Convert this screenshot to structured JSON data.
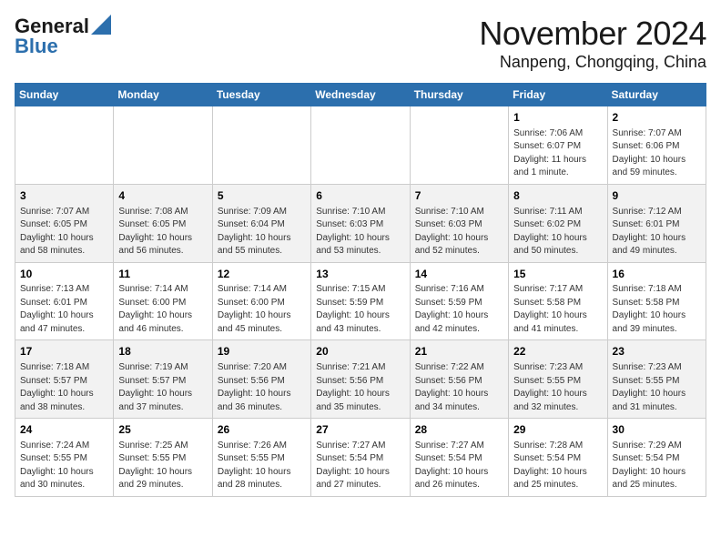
{
  "header": {
    "logo_line1": "General",
    "logo_line2": "Blue",
    "month": "November 2024",
    "location": "Nanpeng, Chongqing, China"
  },
  "weekdays": [
    "Sunday",
    "Monday",
    "Tuesday",
    "Wednesday",
    "Thursday",
    "Friday",
    "Saturday"
  ],
  "weeks": [
    [
      {
        "day": "",
        "info": ""
      },
      {
        "day": "",
        "info": ""
      },
      {
        "day": "",
        "info": ""
      },
      {
        "day": "",
        "info": ""
      },
      {
        "day": "",
        "info": ""
      },
      {
        "day": "1",
        "info": "Sunrise: 7:06 AM\nSunset: 6:07 PM\nDaylight: 11 hours\nand 1 minute."
      },
      {
        "day": "2",
        "info": "Sunrise: 7:07 AM\nSunset: 6:06 PM\nDaylight: 10 hours\nand 59 minutes."
      }
    ],
    [
      {
        "day": "3",
        "info": "Sunrise: 7:07 AM\nSunset: 6:05 PM\nDaylight: 10 hours\nand 58 minutes."
      },
      {
        "day": "4",
        "info": "Sunrise: 7:08 AM\nSunset: 6:05 PM\nDaylight: 10 hours\nand 56 minutes."
      },
      {
        "day": "5",
        "info": "Sunrise: 7:09 AM\nSunset: 6:04 PM\nDaylight: 10 hours\nand 55 minutes."
      },
      {
        "day": "6",
        "info": "Sunrise: 7:10 AM\nSunset: 6:03 PM\nDaylight: 10 hours\nand 53 minutes."
      },
      {
        "day": "7",
        "info": "Sunrise: 7:10 AM\nSunset: 6:03 PM\nDaylight: 10 hours\nand 52 minutes."
      },
      {
        "day": "8",
        "info": "Sunrise: 7:11 AM\nSunset: 6:02 PM\nDaylight: 10 hours\nand 50 minutes."
      },
      {
        "day": "9",
        "info": "Sunrise: 7:12 AM\nSunset: 6:01 PM\nDaylight: 10 hours\nand 49 minutes."
      }
    ],
    [
      {
        "day": "10",
        "info": "Sunrise: 7:13 AM\nSunset: 6:01 PM\nDaylight: 10 hours\nand 47 minutes."
      },
      {
        "day": "11",
        "info": "Sunrise: 7:14 AM\nSunset: 6:00 PM\nDaylight: 10 hours\nand 46 minutes."
      },
      {
        "day": "12",
        "info": "Sunrise: 7:14 AM\nSunset: 6:00 PM\nDaylight: 10 hours\nand 45 minutes."
      },
      {
        "day": "13",
        "info": "Sunrise: 7:15 AM\nSunset: 5:59 PM\nDaylight: 10 hours\nand 43 minutes."
      },
      {
        "day": "14",
        "info": "Sunrise: 7:16 AM\nSunset: 5:59 PM\nDaylight: 10 hours\nand 42 minutes."
      },
      {
        "day": "15",
        "info": "Sunrise: 7:17 AM\nSunset: 5:58 PM\nDaylight: 10 hours\nand 41 minutes."
      },
      {
        "day": "16",
        "info": "Sunrise: 7:18 AM\nSunset: 5:58 PM\nDaylight: 10 hours\nand 39 minutes."
      }
    ],
    [
      {
        "day": "17",
        "info": "Sunrise: 7:18 AM\nSunset: 5:57 PM\nDaylight: 10 hours\nand 38 minutes."
      },
      {
        "day": "18",
        "info": "Sunrise: 7:19 AM\nSunset: 5:57 PM\nDaylight: 10 hours\nand 37 minutes."
      },
      {
        "day": "19",
        "info": "Sunrise: 7:20 AM\nSunset: 5:56 PM\nDaylight: 10 hours\nand 36 minutes."
      },
      {
        "day": "20",
        "info": "Sunrise: 7:21 AM\nSunset: 5:56 PM\nDaylight: 10 hours\nand 35 minutes."
      },
      {
        "day": "21",
        "info": "Sunrise: 7:22 AM\nSunset: 5:56 PM\nDaylight: 10 hours\nand 34 minutes."
      },
      {
        "day": "22",
        "info": "Sunrise: 7:23 AM\nSunset: 5:55 PM\nDaylight: 10 hours\nand 32 minutes."
      },
      {
        "day": "23",
        "info": "Sunrise: 7:23 AM\nSunset: 5:55 PM\nDaylight: 10 hours\nand 31 minutes."
      }
    ],
    [
      {
        "day": "24",
        "info": "Sunrise: 7:24 AM\nSunset: 5:55 PM\nDaylight: 10 hours\nand 30 minutes."
      },
      {
        "day": "25",
        "info": "Sunrise: 7:25 AM\nSunset: 5:55 PM\nDaylight: 10 hours\nand 29 minutes."
      },
      {
        "day": "26",
        "info": "Sunrise: 7:26 AM\nSunset: 5:55 PM\nDaylight: 10 hours\nand 28 minutes."
      },
      {
        "day": "27",
        "info": "Sunrise: 7:27 AM\nSunset: 5:54 PM\nDaylight: 10 hours\nand 27 minutes."
      },
      {
        "day": "28",
        "info": "Sunrise: 7:27 AM\nSunset: 5:54 PM\nDaylight: 10 hours\nand 26 minutes."
      },
      {
        "day": "29",
        "info": "Sunrise: 7:28 AM\nSunset: 5:54 PM\nDaylight: 10 hours\nand 25 minutes."
      },
      {
        "day": "30",
        "info": "Sunrise: 7:29 AM\nSunset: 5:54 PM\nDaylight: 10 hours\nand 25 minutes."
      }
    ]
  ]
}
